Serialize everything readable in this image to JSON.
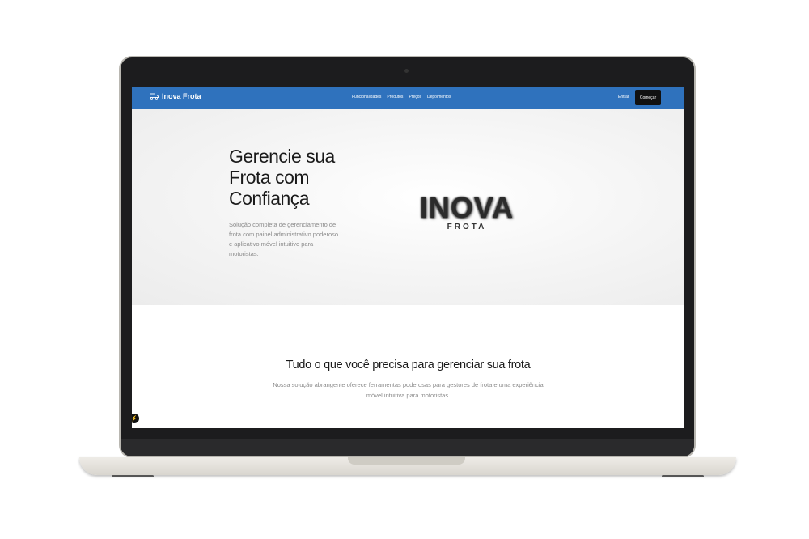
{
  "nav": {
    "brand": "Inova Frota",
    "links": [
      "Funcionalidades",
      "Produtos",
      "Preços",
      "Depoimentos"
    ],
    "login": "Entrar",
    "cta": "Começar"
  },
  "hero": {
    "title": "Gerencie sua Frota com Confiança",
    "subtitle": "Solução completa de gerenciamento de frota com painel administrativo poderoso e aplicativo móvel intuitivo para motoristas.",
    "logo_word": "INOVA",
    "logo_sub": "FROTA"
  },
  "features": {
    "title": "Tudo o que você precisa para gerenciar sua frota",
    "subtitle": "Nossa solução abrangente oferece ferramentas poderosas para gestores de frota e uma experiência móvel intuitiva para motoristas."
  },
  "colors": {
    "nav": "#2f72bd",
    "cta": "#111111"
  },
  "icons": {
    "brand": "truck-icon",
    "floating": "lightning-icon"
  }
}
